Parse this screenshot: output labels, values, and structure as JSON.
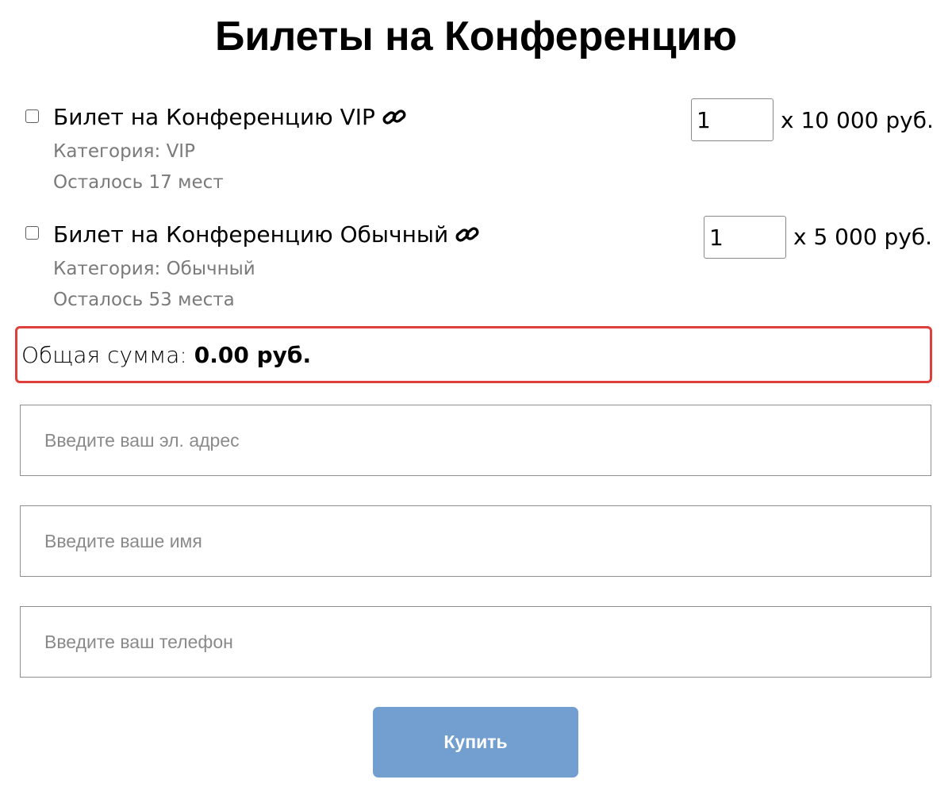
{
  "page": {
    "title": "Билеты на Конференцию"
  },
  "tickets": [
    {
      "name": "Билет на Конференцию VIP",
      "category": "Категория: VIP",
      "remaining": "Осталось 17 мест",
      "quantity": "1",
      "price": "x 10 000 руб.",
      "icon": "link-icon"
    },
    {
      "name": "Билет на Конференцию Обычный",
      "category": "Категория: Обычный",
      "remaining": "Осталось 53 места",
      "quantity": "1",
      "price": "x 5 000 руб.",
      "icon": "link-icon"
    }
  ],
  "total": {
    "label": "Общая сумма:",
    "value": "0.00 руб."
  },
  "form": {
    "email_placeholder": "Введите ваш эл. адрес",
    "name_placeholder": "Введите ваше имя",
    "phone_placeholder": "Введите ваш телефон"
  },
  "buy_button": {
    "label": "Купить"
  },
  "colors": {
    "total_border": "#df3f3a",
    "button_bg": "#729fd0",
    "meta_text": "#7a7a7a"
  }
}
